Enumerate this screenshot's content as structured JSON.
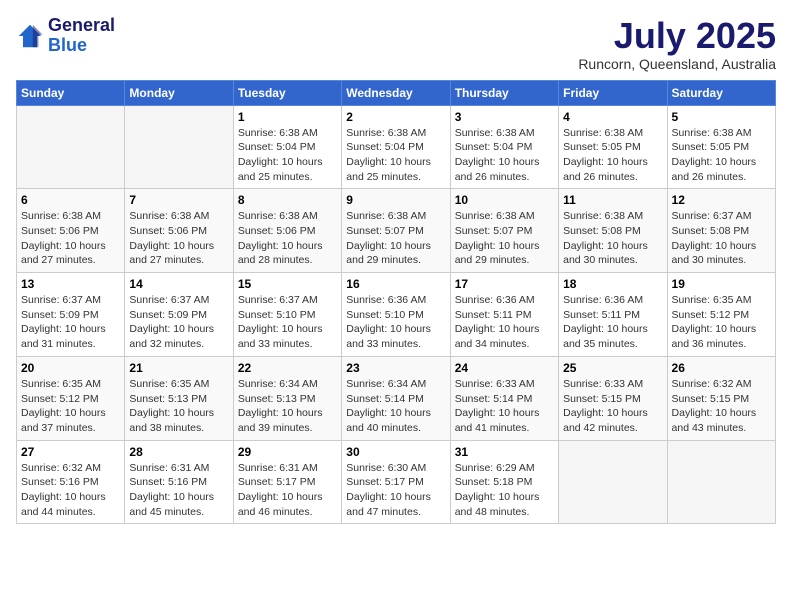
{
  "header": {
    "logo_line1": "General",
    "logo_line2": "Blue",
    "month": "July 2025",
    "location": "Runcorn, Queensland, Australia"
  },
  "weekdays": [
    "Sunday",
    "Monday",
    "Tuesday",
    "Wednesday",
    "Thursday",
    "Friday",
    "Saturday"
  ],
  "weeks": [
    [
      {
        "day": "",
        "info": ""
      },
      {
        "day": "",
        "info": ""
      },
      {
        "day": "1",
        "info": "Sunrise: 6:38 AM\nSunset: 5:04 PM\nDaylight: 10 hours and 25 minutes."
      },
      {
        "day": "2",
        "info": "Sunrise: 6:38 AM\nSunset: 5:04 PM\nDaylight: 10 hours and 25 minutes."
      },
      {
        "day": "3",
        "info": "Sunrise: 6:38 AM\nSunset: 5:04 PM\nDaylight: 10 hours and 26 minutes."
      },
      {
        "day": "4",
        "info": "Sunrise: 6:38 AM\nSunset: 5:05 PM\nDaylight: 10 hours and 26 minutes."
      },
      {
        "day": "5",
        "info": "Sunrise: 6:38 AM\nSunset: 5:05 PM\nDaylight: 10 hours and 26 minutes."
      }
    ],
    [
      {
        "day": "6",
        "info": "Sunrise: 6:38 AM\nSunset: 5:06 PM\nDaylight: 10 hours and 27 minutes."
      },
      {
        "day": "7",
        "info": "Sunrise: 6:38 AM\nSunset: 5:06 PM\nDaylight: 10 hours and 27 minutes."
      },
      {
        "day": "8",
        "info": "Sunrise: 6:38 AM\nSunset: 5:06 PM\nDaylight: 10 hours and 28 minutes."
      },
      {
        "day": "9",
        "info": "Sunrise: 6:38 AM\nSunset: 5:07 PM\nDaylight: 10 hours and 29 minutes."
      },
      {
        "day": "10",
        "info": "Sunrise: 6:38 AM\nSunset: 5:07 PM\nDaylight: 10 hours and 29 minutes."
      },
      {
        "day": "11",
        "info": "Sunrise: 6:38 AM\nSunset: 5:08 PM\nDaylight: 10 hours and 30 minutes."
      },
      {
        "day": "12",
        "info": "Sunrise: 6:37 AM\nSunset: 5:08 PM\nDaylight: 10 hours and 30 minutes."
      }
    ],
    [
      {
        "day": "13",
        "info": "Sunrise: 6:37 AM\nSunset: 5:09 PM\nDaylight: 10 hours and 31 minutes."
      },
      {
        "day": "14",
        "info": "Sunrise: 6:37 AM\nSunset: 5:09 PM\nDaylight: 10 hours and 32 minutes."
      },
      {
        "day": "15",
        "info": "Sunrise: 6:37 AM\nSunset: 5:10 PM\nDaylight: 10 hours and 33 minutes."
      },
      {
        "day": "16",
        "info": "Sunrise: 6:36 AM\nSunset: 5:10 PM\nDaylight: 10 hours and 33 minutes."
      },
      {
        "day": "17",
        "info": "Sunrise: 6:36 AM\nSunset: 5:11 PM\nDaylight: 10 hours and 34 minutes."
      },
      {
        "day": "18",
        "info": "Sunrise: 6:36 AM\nSunset: 5:11 PM\nDaylight: 10 hours and 35 minutes."
      },
      {
        "day": "19",
        "info": "Sunrise: 6:35 AM\nSunset: 5:12 PM\nDaylight: 10 hours and 36 minutes."
      }
    ],
    [
      {
        "day": "20",
        "info": "Sunrise: 6:35 AM\nSunset: 5:12 PM\nDaylight: 10 hours and 37 minutes."
      },
      {
        "day": "21",
        "info": "Sunrise: 6:35 AM\nSunset: 5:13 PM\nDaylight: 10 hours and 38 minutes."
      },
      {
        "day": "22",
        "info": "Sunrise: 6:34 AM\nSunset: 5:13 PM\nDaylight: 10 hours and 39 minutes."
      },
      {
        "day": "23",
        "info": "Sunrise: 6:34 AM\nSunset: 5:14 PM\nDaylight: 10 hours and 40 minutes."
      },
      {
        "day": "24",
        "info": "Sunrise: 6:33 AM\nSunset: 5:14 PM\nDaylight: 10 hours and 41 minutes."
      },
      {
        "day": "25",
        "info": "Sunrise: 6:33 AM\nSunset: 5:15 PM\nDaylight: 10 hours and 42 minutes."
      },
      {
        "day": "26",
        "info": "Sunrise: 6:32 AM\nSunset: 5:15 PM\nDaylight: 10 hours and 43 minutes."
      }
    ],
    [
      {
        "day": "27",
        "info": "Sunrise: 6:32 AM\nSunset: 5:16 PM\nDaylight: 10 hours and 44 minutes."
      },
      {
        "day": "28",
        "info": "Sunrise: 6:31 AM\nSunset: 5:16 PM\nDaylight: 10 hours and 45 minutes."
      },
      {
        "day": "29",
        "info": "Sunrise: 6:31 AM\nSunset: 5:17 PM\nDaylight: 10 hours and 46 minutes."
      },
      {
        "day": "30",
        "info": "Sunrise: 6:30 AM\nSunset: 5:17 PM\nDaylight: 10 hours and 47 minutes."
      },
      {
        "day": "31",
        "info": "Sunrise: 6:29 AM\nSunset: 5:18 PM\nDaylight: 10 hours and 48 minutes."
      },
      {
        "day": "",
        "info": ""
      },
      {
        "day": "",
        "info": ""
      }
    ]
  ]
}
